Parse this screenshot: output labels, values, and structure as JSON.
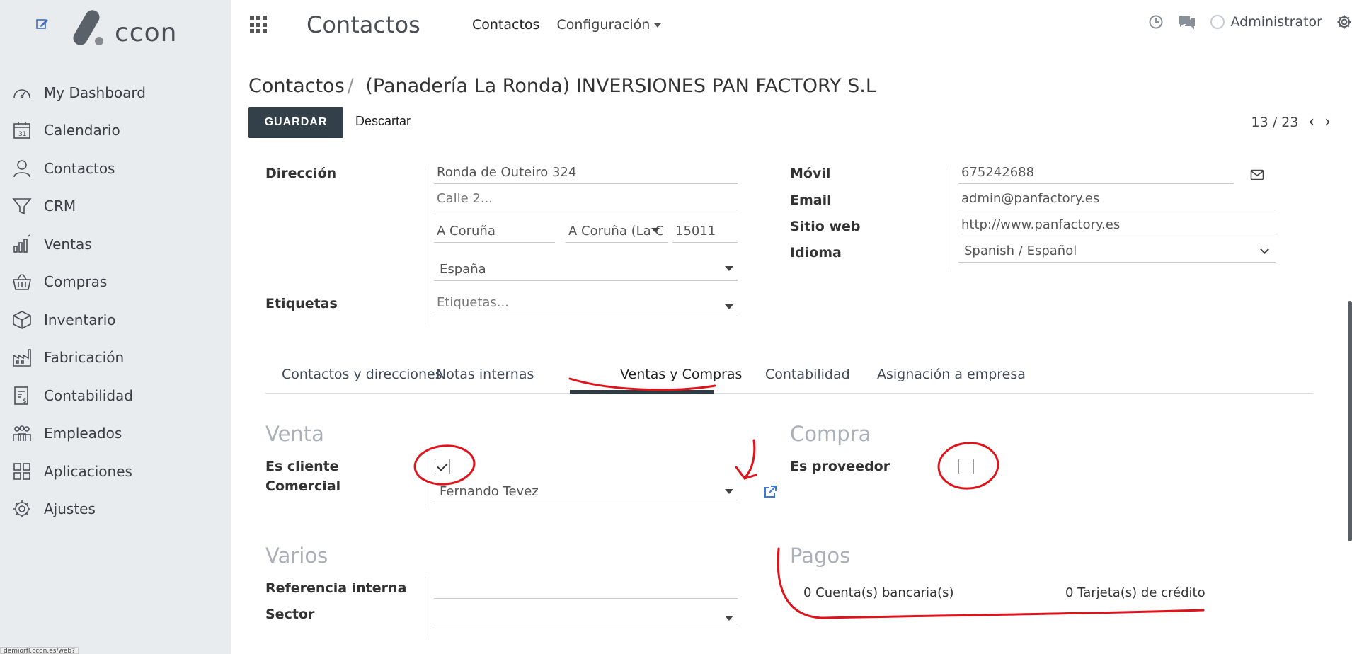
{
  "sidebar": {
    "logo_text": "ccon",
    "items": [
      {
        "label": "My Dashboard",
        "icon": "gauge-icon"
      },
      {
        "label": "Calendario",
        "icon": "calendar-icon"
      },
      {
        "label": "Contactos",
        "icon": "user-icon"
      },
      {
        "label": "CRM",
        "icon": "funnel-icon"
      },
      {
        "label": "Ventas",
        "icon": "bar-chart-icon"
      },
      {
        "label": "Compras",
        "icon": "basket-icon"
      },
      {
        "label": "Inventario",
        "icon": "box-icon"
      },
      {
        "label": "Fabricación",
        "icon": "factory-icon"
      },
      {
        "label": "Contabilidad",
        "icon": "invoice-icon"
      },
      {
        "label": "Empleados",
        "icon": "people-icon"
      },
      {
        "label": "Aplicaciones",
        "icon": "apps-icon"
      },
      {
        "label": "Ajustes",
        "icon": "gear-icon"
      }
    ]
  },
  "topbar": {
    "app_title": "Contactos",
    "menu_contactos": "Contactos",
    "menu_configuracion": "Configuración",
    "user": "Administrator"
  },
  "control": {
    "breadcrumb_root": "Contactos",
    "breadcrumb_sep": "/",
    "breadcrumb_current": "(Panadería La Ronda) INVERSIONES PAN FACTORY S.L",
    "save_label": "GUARDAR",
    "discard_label": "Descartar",
    "pager": "13 / 23"
  },
  "form": {
    "address_label": "Dirección",
    "street": "Ronda de Outeiro 324",
    "street2_placeholder": "Calle 2...",
    "city": "A Coruña",
    "state": "A Coruña (La C",
    "zip": "15011",
    "country": "España",
    "tags_label": "Etiquetas",
    "tags_placeholder": "Etiquetas...",
    "mobile_label": "Móvil",
    "mobile": "675242688",
    "email_label": "Email",
    "email": "admin@panfactory.es",
    "website_label": "Sitio web",
    "website": "http://www.panfactory.es",
    "lang_label": "Idioma",
    "lang": "Spanish / Español"
  },
  "tabs": [
    "Contactos y direcciones",
    "Notas internas",
    "Ventas y Compras",
    "Contabilidad",
    "Asignación a empresa"
  ],
  "sales": {
    "venta_title": "Venta",
    "es_cliente_label": "Es cliente",
    "es_cliente": true,
    "comercial_label": "Comercial",
    "comercial": "Fernando Tevez",
    "compra_title": "Compra",
    "es_proveedor_label": "Es proveedor",
    "es_proveedor": false,
    "varios_title": "Varios",
    "ref_label": "Referencia interna",
    "sector_label": "Sector",
    "pagos_title": "Pagos",
    "bank_accounts": "0 Cuenta(s) bancaria(s)",
    "credit_cards": "0 Tarjeta(s) de crédito"
  },
  "status_url": "demiorfl.ccon.es/web?",
  "colors": {
    "primary": "#344049",
    "sidebar_bg": "#e9ecef",
    "annotation": "#e0131b"
  }
}
